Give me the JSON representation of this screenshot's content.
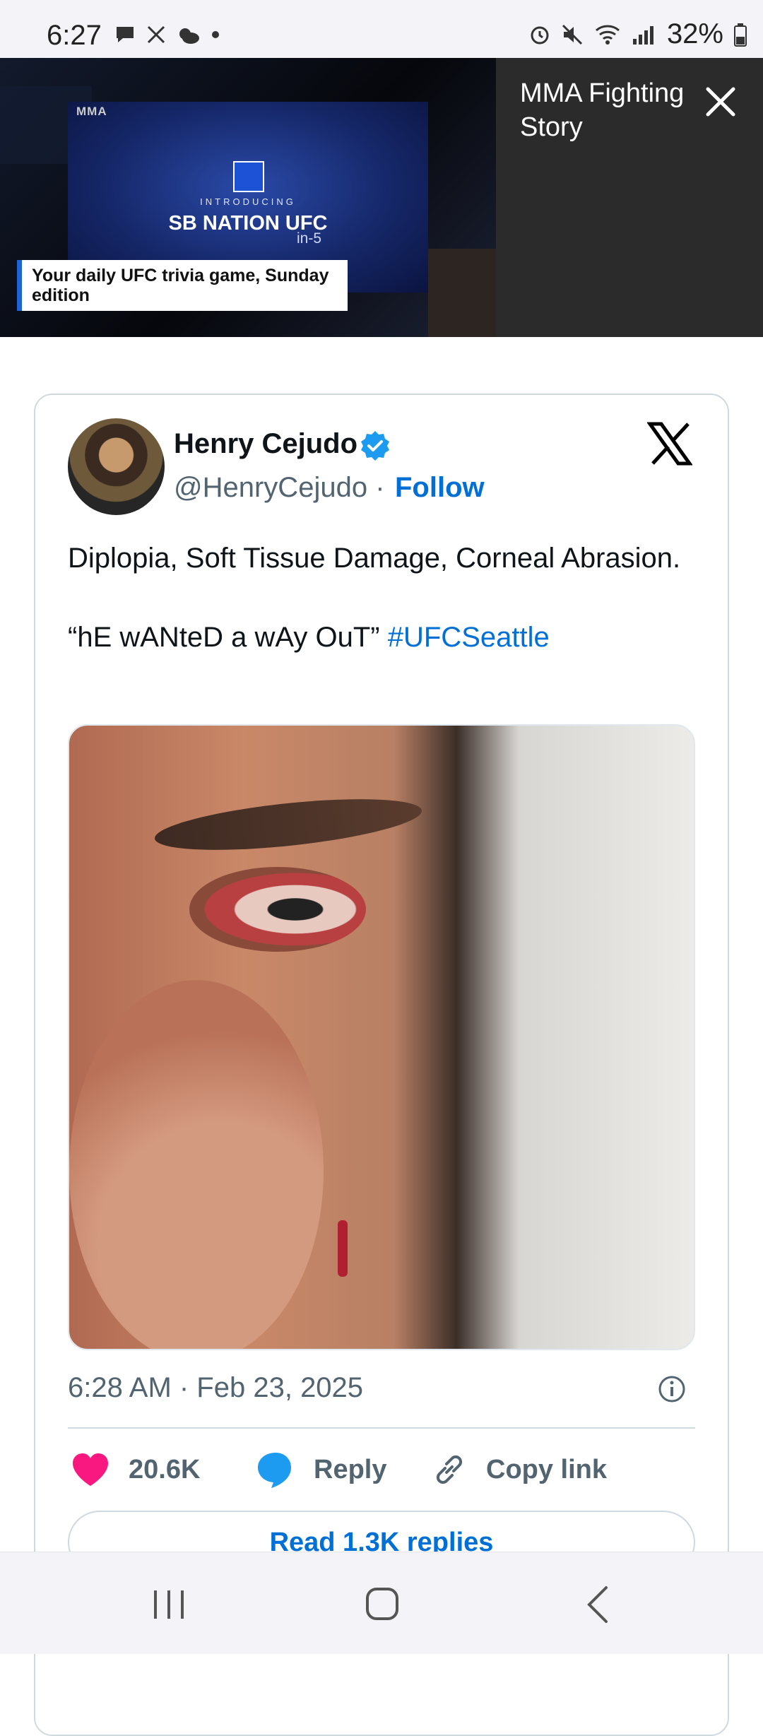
{
  "status_bar": {
    "time": "6:27",
    "battery": "32%"
  },
  "banner": {
    "logo": "MMA",
    "intro": "INTRODUCING",
    "headline": "SB NATION UFC",
    "subheadline": "in-5",
    "caption": "Your daily UFC trivia game, Sunday edition",
    "story_title": "MMA Fighting Story",
    "accent_color": "#1e63d6"
  },
  "tweet": {
    "author_name": "Henry Cejudo",
    "handle": "@HenryCejudo",
    "separator": "·",
    "follow_label": "Follow",
    "text_line1": "Diplopia, Soft Tissue Damage, Corneal Abrasion.",
    "text_line2": "“hE wANteD a wAy OuT”",
    "hashtag": "#UFCSeattle",
    "timestamp": "6:28 AM · Feb 23, 2025",
    "likes": "20.6K",
    "reply_label": "Reply",
    "copy_link_label": "Copy link",
    "read_replies_label": "Read 1.3K replies",
    "link_color": "#006fd6",
    "like_color": "#f91880",
    "verified_color": "#1d9bf0"
  },
  "icons": {
    "notification": "chat-bubble-icon",
    "close": "close-icon",
    "x_logo": "x-logo-icon",
    "verified": "verified-badge-icon",
    "info": "info-icon",
    "like": "heart-icon",
    "reply": "reply-bubble-icon",
    "copy": "link-icon"
  }
}
